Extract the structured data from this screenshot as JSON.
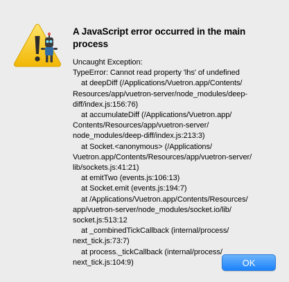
{
  "dialog": {
    "icon": "warning-triangle-with-app-badge-icon",
    "title": "A JavaScript error occurred in the main\nprocess",
    "message": "Uncaught Exception:\nTypeError: Cannot read property 'lhs' of undefined\n    at deepDiff (/Applications/Vuetron.app/Contents/\nResources/app/vuetron-server/node_modules/deep-\ndiff/index.js:156:76)\n    at accumulateDiff (/Applications/Vuetron.app/\nContents/Resources/app/vuetron-server/\nnode_modules/deep-diff/index.js:213:3)\n    at Socket.<anonymous> (/Applications/\nVuetron.app/Contents/Resources/app/vuetron-server/\nlib/sockets.js:41:21)\n    at emitTwo (events.js:106:13)\n    at Socket.emit (events.js:194:7)\n    at /Applications/Vuetron.app/Contents/Resources/\napp/vuetron-server/node_modules/socket.io/lib/\nsocket.js:513:12\n    at _combinedTickCallback (internal/process/\nnext_tick.js:73:7)\n    at process._tickCallback (internal/process/\nnext_tick.js:104:9)",
    "ok_label": "OK"
  },
  "colors": {
    "background": "#ececec",
    "warning_yellow": "#f7c51f",
    "button_blue": "#1a82fb"
  }
}
